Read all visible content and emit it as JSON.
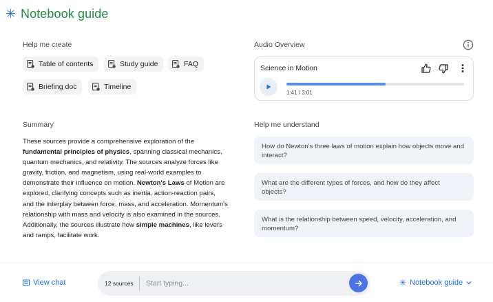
{
  "header": {
    "title": "Notebook guide",
    "icon": "sparkle-icon",
    "accent": "#1e8e3e"
  },
  "help_create": {
    "label": "Help me create",
    "chips": [
      {
        "label": "Table of contents"
      },
      {
        "label": "Study guide"
      },
      {
        "label": "FAQ"
      },
      {
        "label": "Briefing doc"
      },
      {
        "label": "Timeline"
      }
    ]
  },
  "audio": {
    "label": "Audio Overview",
    "title": "Science in Motion",
    "time": "1:41 / 3:01",
    "progress": 0.56
  },
  "summary": {
    "label": "Summary",
    "parts": [
      {
        "text": "These sources provide a comprehensive exploration of the ",
        "bold": false
      },
      {
        "text": "fundamental principles of physics",
        "bold": true
      },
      {
        "text": ", spanning classical mechanics, quantum mechanics, and relativity. The sources analyze forces like gravity, friction, and magnetism, using real-world examples to demonstrate their influence on motion. ",
        "bold": false
      },
      {
        "text": "Newton's Laws",
        "bold": true
      },
      {
        "text": " of Motion are explored, clarifying concepts such as inertia, action-reaction pairs, and the interplay between force, mass, and acceleration. Momentum's relationship with mass and velocity is also examined in the sources. Additionally, the sources illustrate how ",
        "bold": false
      },
      {
        "text": "simple machines",
        "bold": true
      },
      {
        "text": ", like levers and ramps, facilitate work.",
        "bold": false
      }
    ]
  },
  "understand": {
    "label": "Help me understand",
    "questions": [
      "How do Newton's three laws of motion explain how objects move and interact?",
      "What are the different types of forces, and how do they affect objects?",
      "What is the relationship between speed, velocity, acceleration, and momentum?"
    ]
  },
  "footer": {
    "view_chat": "View chat",
    "sources": "12 sources",
    "placeholder": "Start typing...",
    "notebook_guide": "Notebook guide"
  }
}
